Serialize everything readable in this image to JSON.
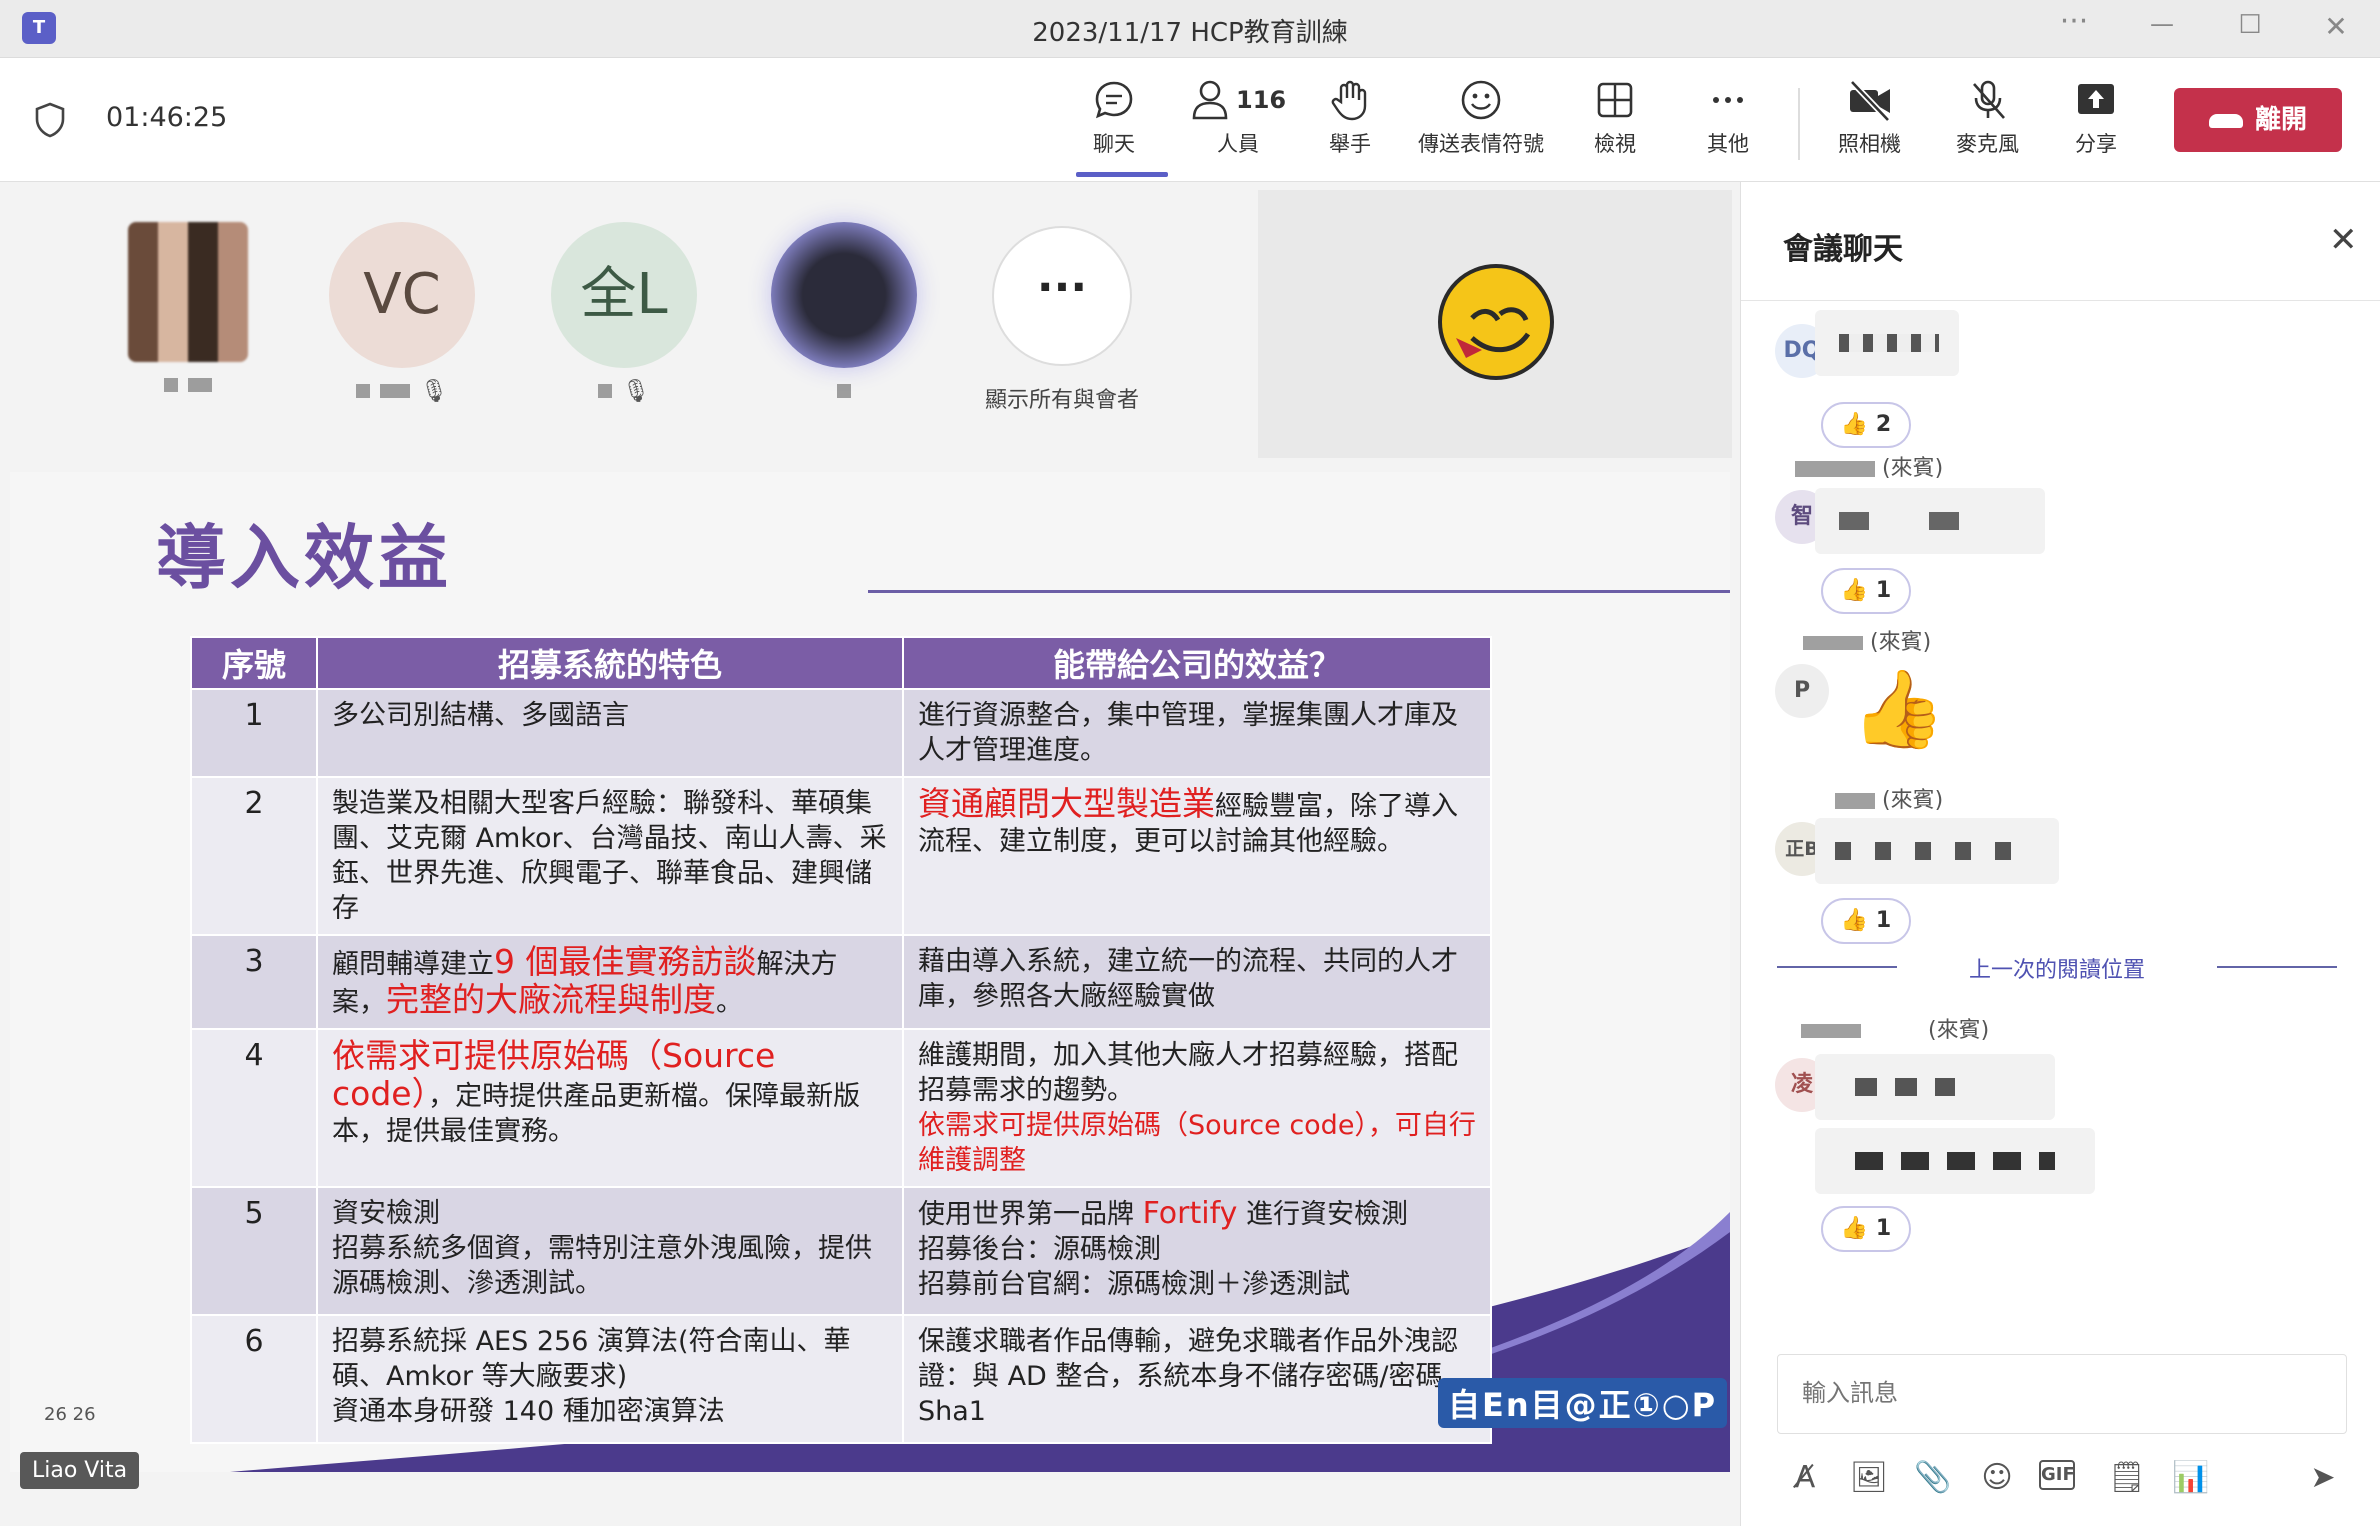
{
  "window": {
    "title": "2023/11/17 HCP教育訓練",
    "app_logo": "T",
    "more": "···",
    "minimize": "—",
    "maximize": "☐",
    "close": "✕"
  },
  "toolbar": {
    "timer": "01:46:25",
    "chat": "聊天",
    "people": "人員",
    "people_count": "116",
    "raise_hand": "舉手",
    "reactions": "傳送表情符號",
    "view": "檢視",
    "more": "其他",
    "camera": "照相機",
    "mic": "麥克風",
    "share": "分享",
    "leave": "離開"
  },
  "participants": [
    {
      "initials": ""
    },
    {
      "initials": "VC"
    },
    {
      "initials": "全L"
    },
    {
      "initials": ""
    }
  ],
  "show_all_label": "顯示所有與會者",
  "slide": {
    "title": "導入效益",
    "headers": [
      "序號",
      "招募系統的特色",
      "能帶給公司的效益？"
    ],
    "rows": [
      {
        "num": "1",
        "feature": "多公司別結構、多國語言",
        "benefit": "進行資源整合，集中管理，掌握集團人才庫及人才管理進度。"
      },
      {
        "num": "2",
        "feature": "製造業及相關大型客戶經驗：聯發科、華碩集團、艾克爾 Amkor、台灣晶技、南山人壽、采鈺、世界先進、欣興電子、聯華食品、建興儲存",
        "benefit_red": "資通顧問大型製造業",
        "benefit": "經驗豐富，除了導入流程、建立制度，更可以討論其他經驗。"
      },
      {
        "num": "3",
        "feature_a": "顧問輔導建立",
        "feature_red_a": "9 個最佳實務訪談",
        "feature_b": "解決方案，",
        "feature_red_b": "完整的大廠流程與制度",
        "feature_c": "。",
        "benefit": "藉由導入系統，建立統一的流程、共同的人才庫，參照各大廠經驗實做"
      },
      {
        "num": "4",
        "feature_red": "依需求可提供原始碼（Source code）",
        "feature": "，定時提供產品更新檔。保障最新版本，提供最佳實務。",
        "benefit": "維護期間，加入其他大廠人才招募經驗，搭配招募需求的趨勢。",
        "benefit_red": "依需求可提供原始碼（Source code），可自行維護調整"
      },
      {
        "num": "5",
        "feature": "資安檢測\n招募系統多個資，需特別注意外洩風險，提供源碼檢測、滲透測試。",
        "benefit_a": "使用世界第一品牌 ",
        "benefit_red": "Fortify",
        "benefit_b": " 進行資安檢測\n招募後台：源碼檢測\n招募前台官網：源碼檢測＋滲透測試"
      },
      {
        "num": "6",
        "feature": "招募系統採 AES 256 演算法(符合南山、華碩、Amkor 等大廠要求)\n資通本身研發 140 種加密演算法",
        "benefit": "保護求職者作品傳輸，避免求職者作品外洩認證：與 AD 整合，系統本身不儲存密碼/密碼 Sha1"
      }
    ],
    "page_num": "26 26",
    "logo_text": "自En目@正①○P"
  },
  "presenter_name": "Liao Vita",
  "chat": {
    "title": "會議聊天",
    "messages": [
      {
        "avatar": "DQ",
        "sender": "",
        "reaction_count": "2",
        "avatar_bg": "#e8eef8",
        "avatar_fg": "#5a6fa8"
      },
      {
        "avatar": "智",
        "sender": "(來賓)",
        "reaction_count": "1",
        "avatar_bg": "#e6e1ee",
        "avatar_fg": "#5d4b7e"
      },
      {
        "avatar": "P",
        "sender": "(來賓)",
        "reaction_count": "",
        "avatar_bg": "#eeeeee",
        "avatar_fg": "#555555"
      },
      {
        "avatar": "正B",
        "sender": "(來賓)",
        "reaction_count": "1",
        "avatar_bg": "#eceae2",
        "avatar_fg": "#555555"
      },
      {
        "avatar": "凌",
        "sender": "(來賓)",
        "reaction_count": "1",
        "avatar_bg": "#f4e4e4",
        "avatar_fg": "#a05050"
      }
    ],
    "last_read": "上一次的閱讀位置",
    "input_placeholder": "輸入訊息",
    "tools": [
      "format-icon",
      "image-icon",
      "attach-icon",
      "emoji-icon",
      "gif-icon",
      "sticker-icon",
      "poll-icon",
      "send-icon"
    ]
  },
  "colors": {
    "accent": "#5b5fc7",
    "leave": "#c4314b",
    "slide_header": "#7b5da6",
    "highlight_red": "#e02020"
  }
}
